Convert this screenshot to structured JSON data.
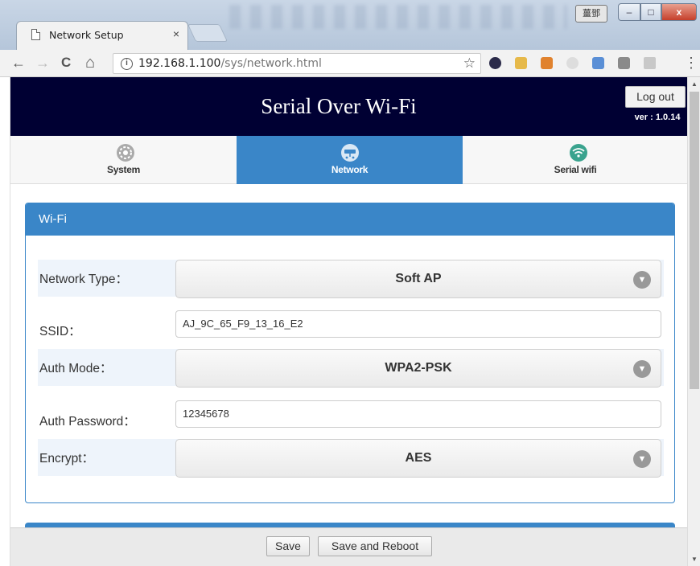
{
  "browser": {
    "tab_title": "Network Setup",
    "tab_close": "×",
    "url_host": "192.168.1.100",
    "url_path": "/sys/network.html",
    "ime_label": "薑鄧",
    "nav": {
      "back": "←",
      "forward": "→",
      "reload": "C",
      "home": "⌂"
    },
    "star": "☆",
    "menu": "⋮",
    "window_buttons": {
      "minimize": "–",
      "maximize": "□",
      "close": "x"
    },
    "extensions": [
      "chrome-ext-icon",
      "bookmark-ext-icon",
      "puzzle-ext-icon",
      "gray-ext-icon",
      "translate-ext-icon",
      "gray-ext-icon-2",
      "drive-ext-icon"
    ]
  },
  "header": {
    "title": "Serial Over Wi-Fi",
    "logout_label": "Log out",
    "version": "ver : 1.0.14"
  },
  "nav_tabs": [
    {
      "label": "System",
      "icon": "gear-icon",
      "active": false
    },
    {
      "label": "Network",
      "icon": "router-icon",
      "active": true
    },
    {
      "label": "Serial wifi",
      "icon": "wifi-icon",
      "active": false
    }
  ],
  "wifi_panel": {
    "title": "Wi-Fi",
    "network_type": {
      "label": "Network Type：",
      "value": "Soft AP"
    },
    "ssid": {
      "label": "SSID：",
      "value": "AJ_9C_65_F9_13_16_E2"
    },
    "auth_mode": {
      "label": "Auth Mode：",
      "value": "WPA2-PSK"
    },
    "auth_password": {
      "label": "Auth Password：",
      "value": "12345678"
    },
    "encrypt": {
      "label": "Encrypt：",
      "value": "AES"
    }
  },
  "footer": {
    "save_label": "Save",
    "save_reboot_label": "Save and Reboot"
  },
  "colors": {
    "header_bg": "#000033",
    "accent": "#3a86c8"
  }
}
